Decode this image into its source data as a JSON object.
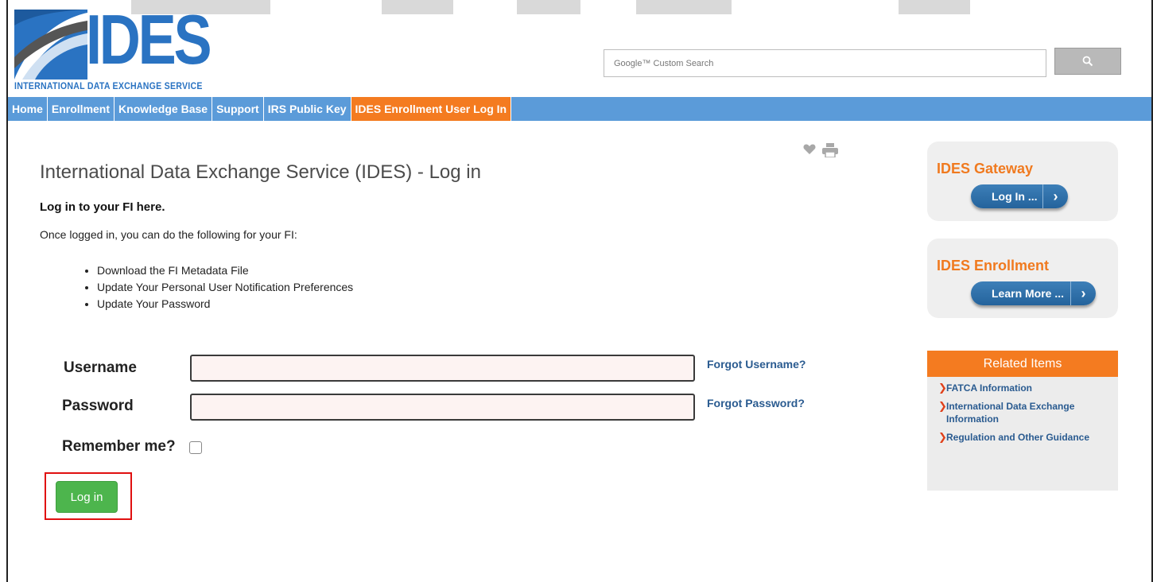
{
  "header": {
    "logo_text": "IDES",
    "logo_subtitle": "INTERNATIONAL DATA EXCHANGE SERVICE",
    "search": {
      "placeholder": "Google™ Custom Search"
    }
  },
  "nav": {
    "items": [
      {
        "label": "Home"
      },
      {
        "label": "Enrollment"
      },
      {
        "label": "Knowledge Base"
      },
      {
        "label": "Support"
      },
      {
        "label": "IRS Public Key"
      },
      {
        "label": "IDES Enrollment User Log In"
      }
    ]
  },
  "main": {
    "title": "International Data Exchange Service (IDES) - Log in",
    "subheading": "Log in to your FI here.",
    "intro": "Once logged in, you can do the following for your FI:",
    "bullets": [
      "Download the FI  Metadata  File",
      "Update Your Personal User Notification Preferences",
      "Update Your Password"
    ],
    "form": {
      "username_label": "Username",
      "password_label": "Password",
      "remember_label": "Remember me?",
      "forgot_username": "Forgot Username?",
      "forgot_password": "Forgot Password?",
      "login_button": "Log in"
    }
  },
  "sidebar": {
    "gateway": {
      "title": "IDES Gateway",
      "button": "Log In ..."
    },
    "enrollment": {
      "title": "IDES Enrollment",
      "button": "Learn More ..."
    },
    "related": {
      "title": "Related Items",
      "items": [
        "FATCA Information",
        "International Data Exchange Information",
        "Regulation and Other Guidance"
      ]
    }
  },
  "colors": {
    "nav_bg": "#5b9bd9",
    "active_tab": "#f47b20",
    "brand_blue": "#2a73c2",
    "login_green": "#4db54d",
    "highlight_red": "#e01010"
  },
  "icons": [
    "search-icon",
    "heart-icon",
    "print-icon",
    "chevron-right-icon"
  ]
}
